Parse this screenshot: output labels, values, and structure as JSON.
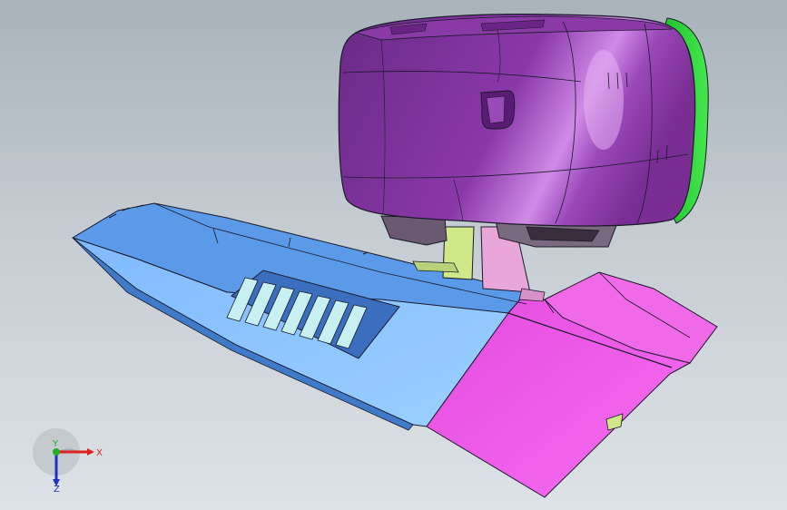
{
  "viewport": {
    "background_top": "#a9b2ba",
    "background_bottom": "#dde2e6"
  },
  "model": {
    "colors": {
      "housing_purple": "#7a2e93",
      "housing_highlight": "#c07bd6",
      "rim_green": "#2fd23a",
      "panel_blue": "#6aa8f2",
      "panel_blue_light": "#8cc3ff",
      "panel_magenta": "#f058e6",
      "stem_lime": "#cfe88a",
      "stem_pink": "#e9a6d8",
      "vent_slats": "#c8f0f0",
      "edge_dark": "#1a1a2a"
    }
  },
  "triad": {
    "x_label": "X",
    "y_label": "Y",
    "z_label": "Z",
    "x_color": "#e02020",
    "y_color": "#20b020",
    "z_color": "#2030c0"
  }
}
